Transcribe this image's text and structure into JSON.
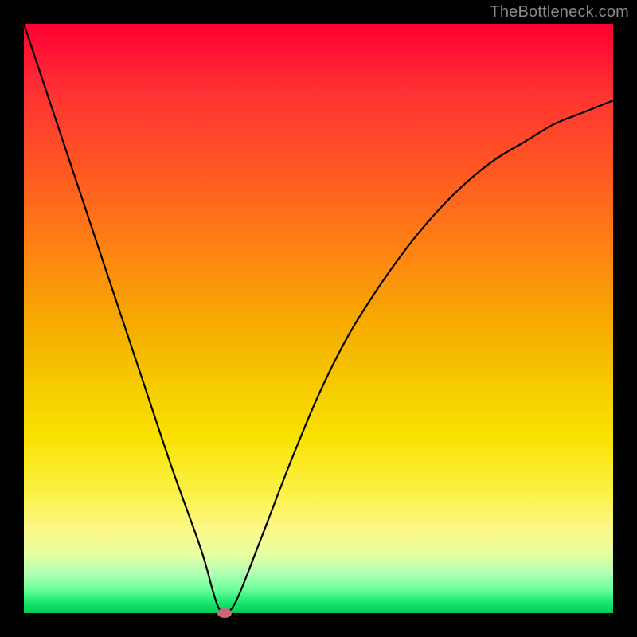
{
  "watermark": "TheBottleneck.com",
  "chart_data": {
    "type": "line",
    "title": "",
    "xlabel": "",
    "ylabel": "",
    "xlim": [
      0,
      100
    ],
    "ylim": [
      0,
      100
    ],
    "grid": false,
    "series": [
      {
        "name": "bottleneck-curve",
        "x": [
          0,
          5,
          10,
          15,
          20,
          25,
          30,
          32,
          33,
          34,
          36,
          40,
          45,
          50,
          55,
          60,
          65,
          70,
          75,
          80,
          85,
          90,
          95,
          100
        ],
        "values": [
          100,
          85,
          70,
          55,
          40,
          25,
          11,
          4,
          1,
          0,
          2,
          12,
          25,
          37,
          47,
          55,
          62,
          68,
          73,
          77,
          80,
          83,
          85,
          87
        ]
      }
    ],
    "annotations": [
      {
        "type": "point",
        "name": "minimum-marker",
        "x": 34,
        "y": 0,
        "color": "#cc6677"
      }
    ],
    "background_gradient": {
      "top": "#ff0033",
      "bottom": "#00cc55"
    }
  }
}
